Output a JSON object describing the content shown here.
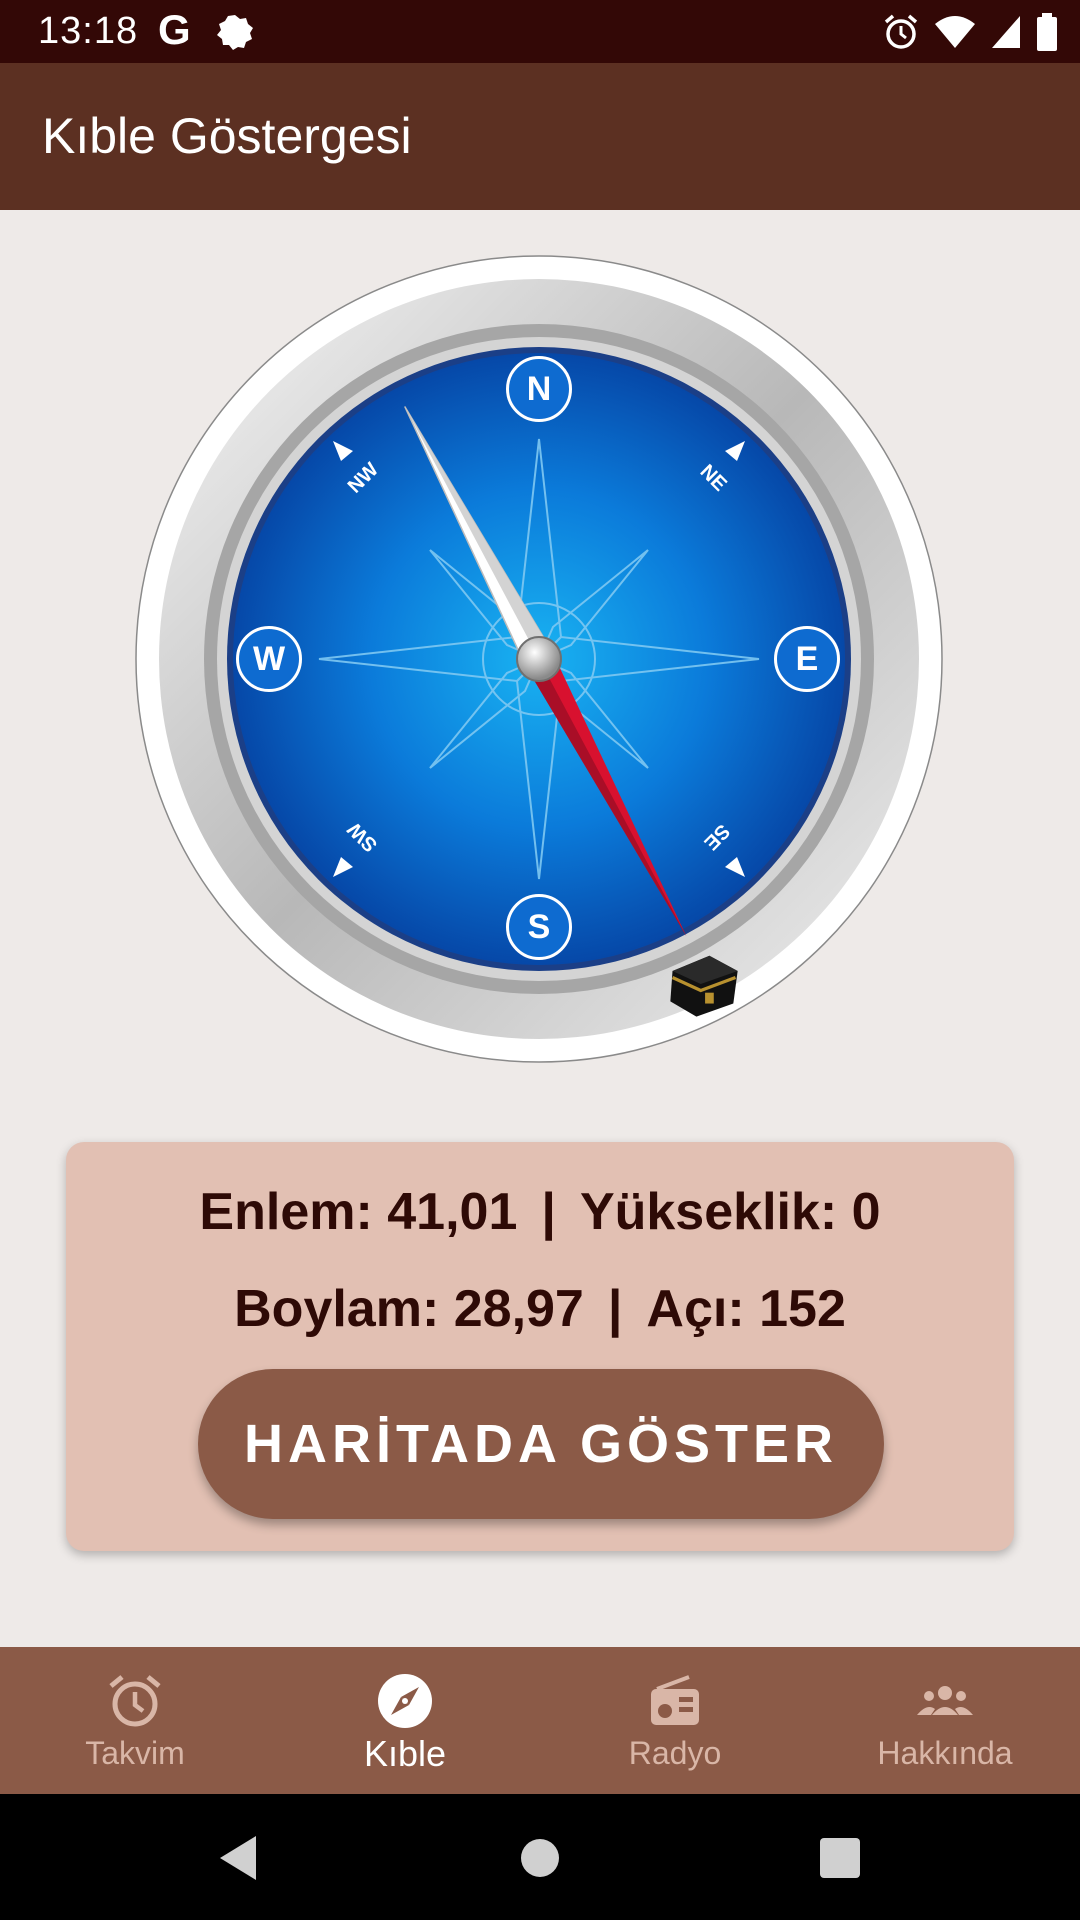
{
  "status_bar": {
    "time": "13:18",
    "left_icons": [
      "google-g-icon",
      "app-notification-icon"
    ],
    "right_icons": [
      "alarm-icon",
      "wifi-icon",
      "cell-signal-icon",
      "battery-icon"
    ],
    "google_letter": "G"
  },
  "app_bar": {
    "title": "Kıble Göstergesi"
  },
  "compass": {
    "cardinals": {
      "n": "N",
      "e": "E",
      "s": "S",
      "w": "W"
    },
    "intercardinals": {
      "ne": "NE",
      "se": "SE",
      "sw": "SW",
      "nw": "NW"
    },
    "qibla_angle_deg": 152,
    "kaaba_icon": "kaaba-icon"
  },
  "info": {
    "latitude_label": "Enlem: 41,01",
    "altitude_label": "Yükseklik: 0",
    "longitude_label": "Boylam: 28,97",
    "angle_label": "Açı: 152",
    "separator": "|",
    "button_label": "HARİTADA GÖSTER"
  },
  "bottom_nav": {
    "items": [
      {
        "label": "Takvim",
        "icon": "alarm-clock-icon",
        "active": false
      },
      {
        "label": "Kıble",
        "icon": "compass-icon",
        "active": true
      },
      {
        "label": "Radyo",
        "icon": "radio-icon",
        "active": false
      },
      {
        "label": "Hakkında",
        "icon": "people-icon",
        "active": false
      }
    ]
  },
  "colors": {
    "status_bar": "#330806",
    "app_bar": "#5C3022",
    "background": "#EEEAE8",
    "card": "#E2C0B3",
    "button": "#8B5A47",
    "nav": "#8B5A47",
    "compass_blue": "#0B63C6",
    "needle_red": "#D8112F"
  }
}
